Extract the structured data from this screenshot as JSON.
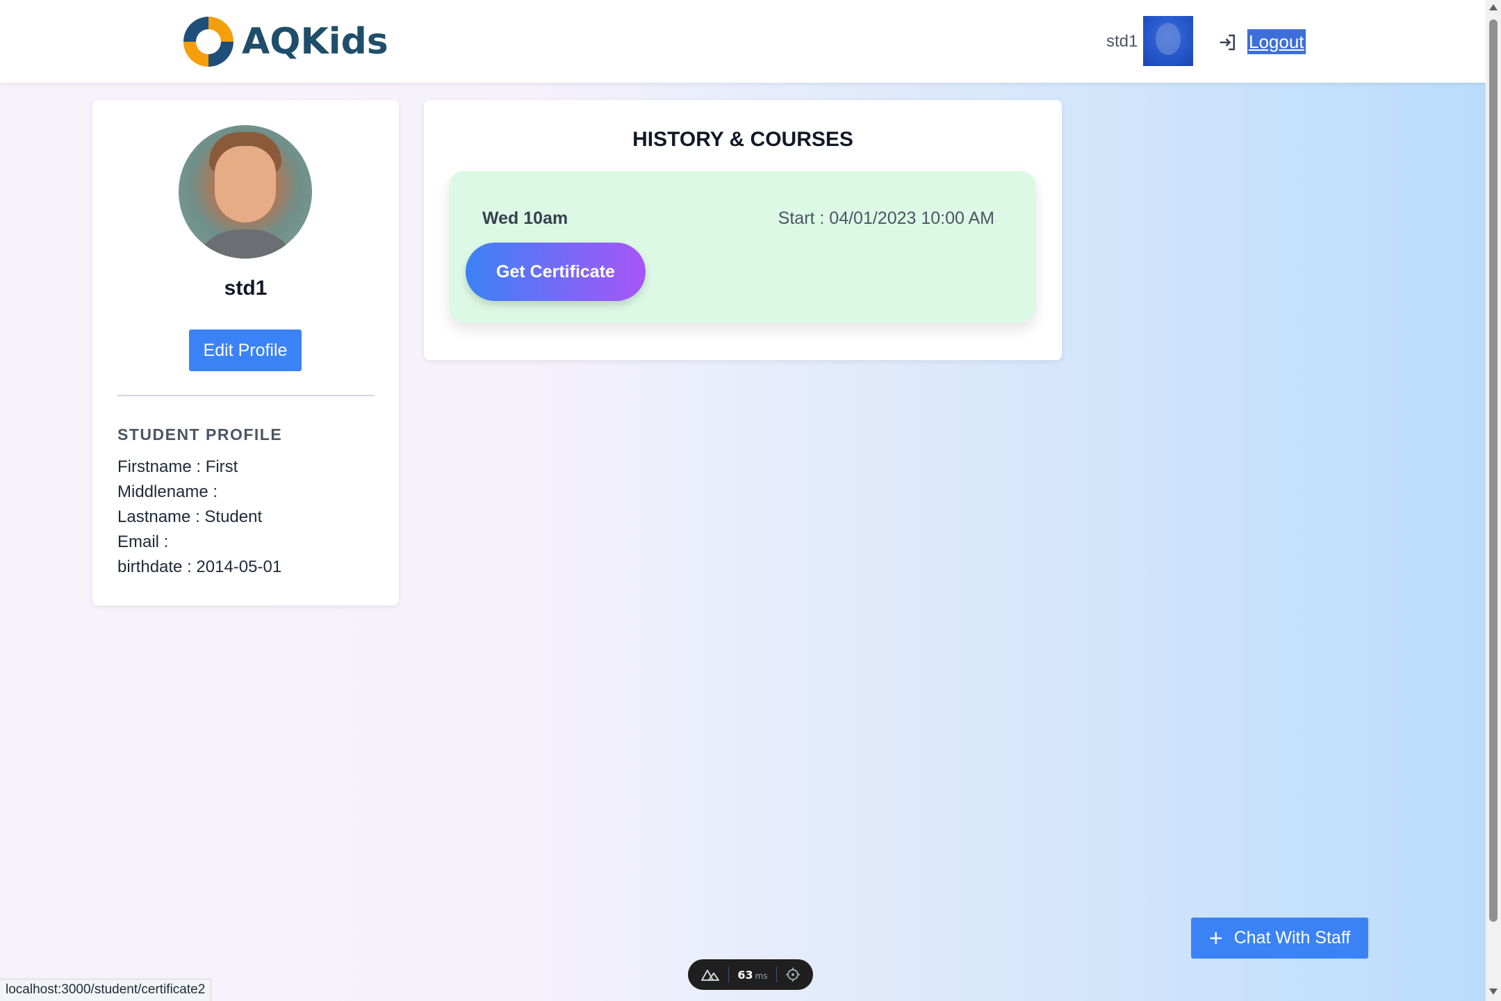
{
  "header": {
    "brand_name": "AQKids",
    "username": "std1",
    "logout_label": "Logout"
  },
  "profile": {
    "name": "std1",
    "edit_label": "Edit Profile",
    "section_title": "STUDENT PROFILE",
    "fields": [
      "Firstname : First",
      "Middlename :",
      "Lastname : Student",
      "Email :",
      "birthdate : 2014-05-01"
    ]
  },
  "history": {
    "title": "HISTORY & COURSES",
    "courses": [
      {
        "name": "Wed 10am",
        "start": "Start : 04/01/2023 10:00 AM",
        "button_label": "Get Certificate"
      }
    ]
  },
  "chat": {
    "label": "Chat With Staff",
    "icon": "plus-icon"
  },
  "dev_toolbar": {
    "ms_value": "63",
    "ms_unit": "ms"
  },
  "status_bar": {
    "url": "localhost:3000/student/certificate2"
  },
  "colors": {
    "primary": "#3b82f6",
    "brand": "#1f4e6b",
    "course_bg": "#dcf9e5",
    "gradient_start": "#3b82f6",
    "gradient_end": "#a855f7"
  }
}
